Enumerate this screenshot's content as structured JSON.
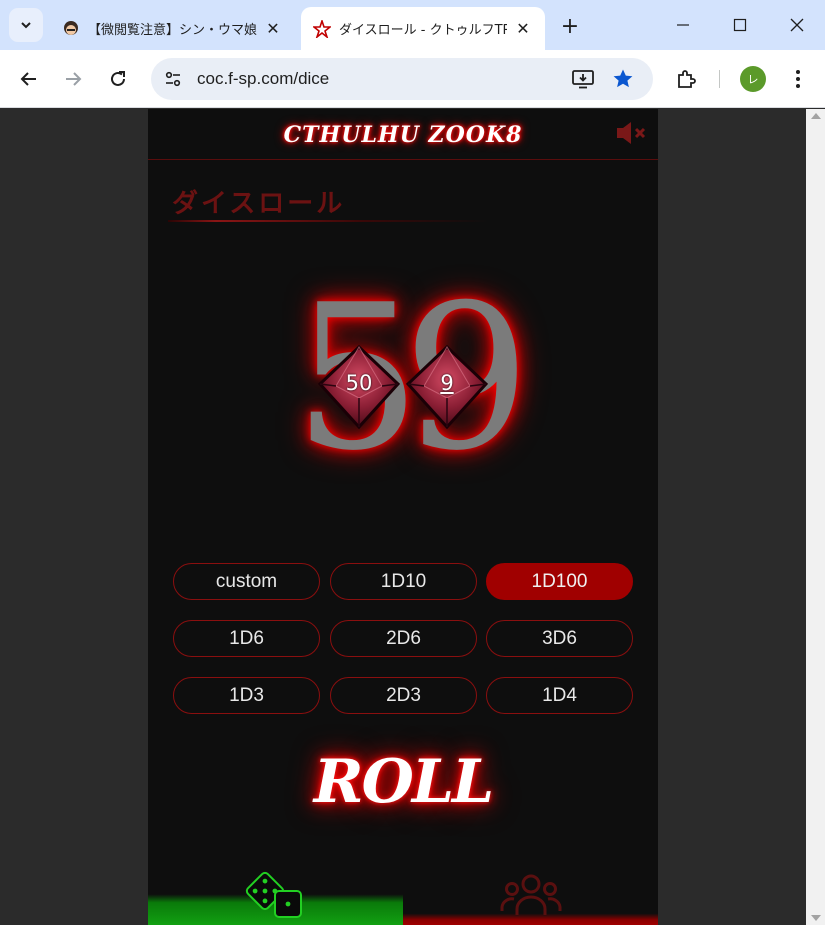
{
  "browser": {
    "tabs": [
      {
        "title": "【微閲覧注意】シン・ウマ娘",
        "active": false,
        "close": "✕"
      },
      {
        "title": "ダイスロール - クトゥルフTR",
        "active": true,
        "close": "✕"
      }
    ],
    "new_tab": "+",
    "url": "coc.f-sp.com/dice",
    "profile_initial": "レ",
    "colors": {
      "tabbar": "#d3e3fd",
      "star": "#0b57d0",
      "profile": "#5b9a2a"
    }
  },
  "app": {
    "logo": "CTHULHU ZOOK8",
    "page_title": "ダイスロール",
    "result": "59",
    "dice": [
      {
        "label": "50",
        "underline": false
      },
      {
        "label": "9",
        "underline": true
      }
    ],
    "buttons": [
      {
        "label": "custom",
        "selected": false
      },
      {
        "label": "1D10",
        "selected": false
      },
      {
        "label": "1D100",
        "selected": true
      },
      {
        "label": "1D6",
        "selected": false
      },
      {
        "label": "2D6",
        "selected": false
      },
      {
        "label": "3D6",
        "selected": false
      },
      {
        "label": "1D3",
        "selected": false
      },
      {
        "label": "2D3",
        "selected": false
      },
      {
        "label": "1D4",
        "selected": false
      }
    ],
    "roll_label": "ROLL",
    "nav": [
      {
        "icon": "dice-icon",
        "active": true
      },
      {
        "icon": "users-icon",
        "active": false
      }
    ],
    "colors": {
      "accent": "#a00000",
      "active_nav": "#12a012",
      "background": "#0e0e0e"
    }
  }
}
